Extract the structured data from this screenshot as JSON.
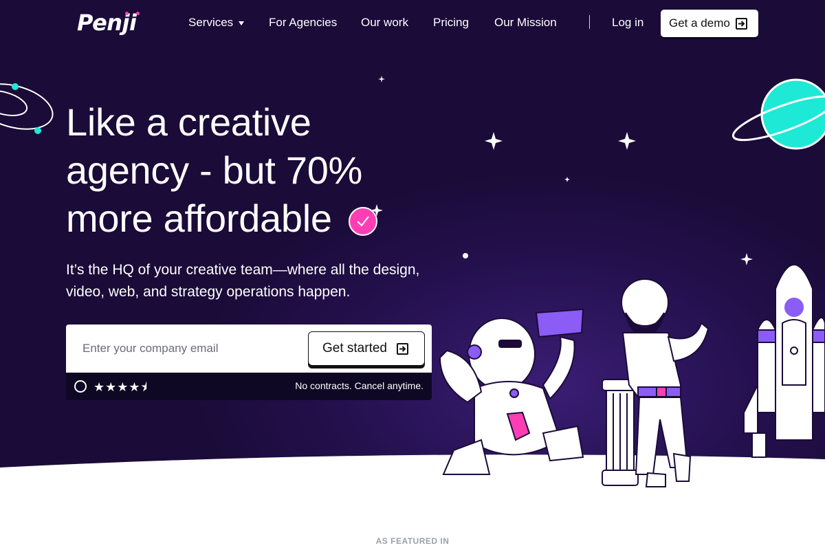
{
  "brand": {
    "name": "Penji",
    "accent": "#ff3eb5",
    "background": "#1f0f44",
    "illustration_purple": "#8b5cf6",
    "planet": "#1de9d6"
  },
  "nav": {
    "items": [
      {
        "label": "Services",
        "dropdown": true
      },
      {
        "label": "For Agencies"
      },
      {
        "label": "Our work"
      },
      {
        "label": "Pricing"
      },
      {
        "label": "Our Mission"
      }
    ],
    "login": "Log in",
    "demo": "Get a demo"
  },
  "hero": {
    "headline_1": "Like a creative",
    "headline_2": "agency - but 70%",
    "headline_3": "more affordable",
    "subtext": "It’s the HQ of your creative team—where all the design, video, web, and strategy operations happen."
  },
  "signup": {
    "email_placeholder": "Enter your company email",
    "email_value": "",
    "cta": "Get started",
    "rating": 4.5,
    "rating_icon": "g2-logo-icon",
    "note": "No contracts. Cancel anytime."
  },
  "featured_label": "AS FEATURED IN"
}
